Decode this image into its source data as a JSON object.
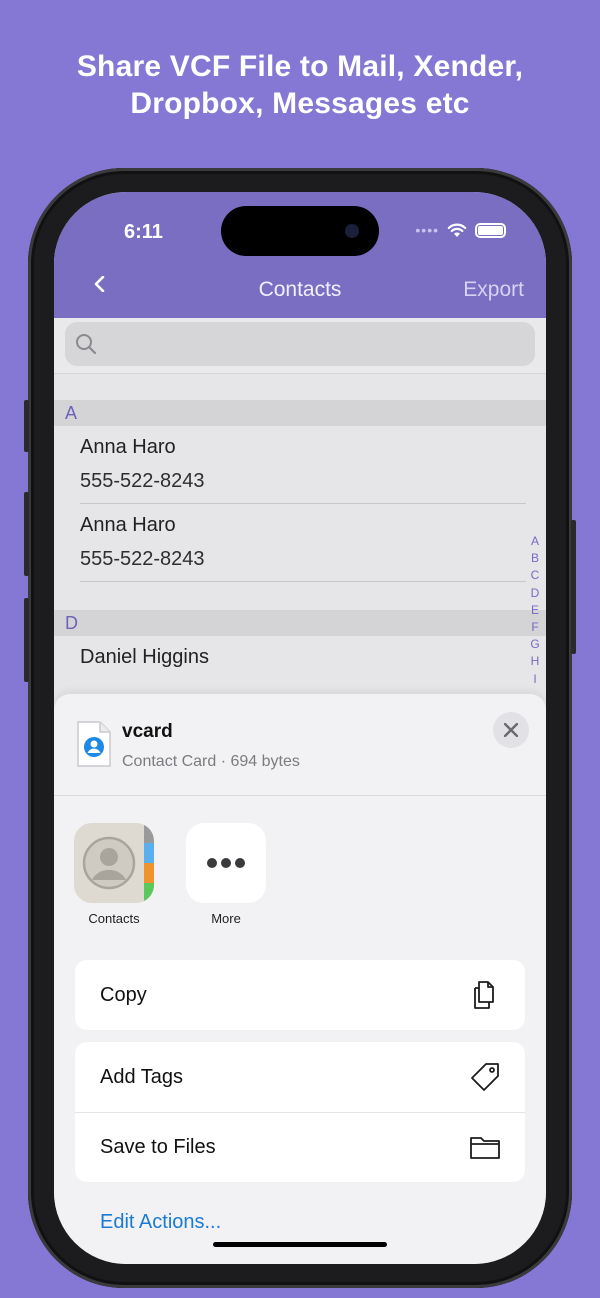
{
  "promo": {
    "line1": "Share VCF File to Mail, Xender,",
    "line2": "Dropbox, Messages etc"
  },
  "status_bar": {
    "time": "6:11",
    "icons": [
      "cellular-dots-icon",
      "wifi-icon",
      "battery-icon"
    ]
  },
  "nav": {
    "back_icon": "chevron-left-icon",
    "title": "Contacts",
    "export_label": "Export"
  },
  "search": {
    "icon": "search-icon",
    "placeholder": ""
  },
  "contacts": {
    "sections": [
      {
        "letter": "A",
        "rows": [
          {
            "name": "Anna Haro",
            "phone": "555-522-8243"
          },
          {
            "name": "Anna Haro",
            "phone": "555-522-8243"
          }
        ]
      },
      {
        "letter": "D",
        "rows": [
          {
            "name": "Daniel Higgins",
            "phone": ""
          }
        ]
      }
    ],
    "index_letters": [
      "A",
      "B",
      "C",
      "D",
      "E",
      "F",
      "G",
      "H",
      "I"
    ]
  },
  "share_sheet": {
    "file_name": "vcard",
    "file_meta": "Contact Card · 694 bytes",
    "file_icon": "contact-card-file-icon",
    "close_icon": "close-icon",
    "apps": [
      {
        "label": "Contacts",
        "icon": "contacts-app-icon"
      },
      {
        "label": "More",
        "icon": "more-ellipsis-icon"
      }
    ],
    "actions_group1": [
      {
        "label": "Copy",
        "icon": "copy-icon"
      }
    ],
    "actions_group2": [
      {
        "label": "Add Tags",
        "icon": "tag-icon"
      },
      {
        "label": "Save to Files",
        "icon": "folder-icon"
      }
    ],
    "edit_actions_label": "Edit Actions..."
  },
  "colors": {
    "background": "#8478d4",
    "nav_bar": "#7a6ec2",
    "section_letter": "#6c62b9",
    "link": "#1a7ad4"
  }
}
